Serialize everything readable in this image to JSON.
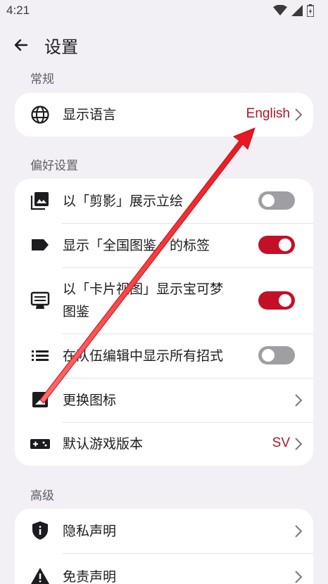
{
  "status": {
    "time": "4:21"
  },
  "appbar": {
    "title": "设置"
  },
  "sections": {
    "general": {
      "label": "常规",
      "display_language": {
        "label": "显示语言",
        "value": "English",
        "icon": "globe-icon"
      }
    },
    "preferences": {
      "label": "偏好设置",
      "silhouette": {
        "label": "以「剪影」展示立绘",
        "icon": "image-icon",
        "toggle_on": false
      },
      "national_dex_tag": {
        "label": "显示「全国图鉴」的标签",
        "icon": "label-tag-icon",
        "toggle_on": true
      },
      "card_view": {
        "label_line1": "以「卡片视图」显示宝可梦",
        "label_line2": "图鉴",
        "icon": "card-view-icon",
        "toggle_on": true
      },
      "all_moves": {
        "label": "在队伍编辑中显示所有招式",
        "icon": "list-icon",
        "toggle_on": false
      },
      "change_icon": {
        "label": "更换图标",
        "icon": "app-icon-icon"
      },
      "game_version": {
        "label": "默认游戏版本",
        "value": "SV",
        "icon": "gamepad-icon"
      }
    },
    "advanced": {
      "label": "高级",
      "privacy": {
        "label": "隐私声明",
        "icon": "shield-icon"
      },
      "disclaimer": {
        "label": "免责声明",
        "icon": "warning-icon"
      }
    }
  },
  "colors": {
    "accent": "#c41026",
    "background": "#f2f0f5",
    "card": "#ffffff",
    "annotation_arrow": "#e8141c"
  }
}
